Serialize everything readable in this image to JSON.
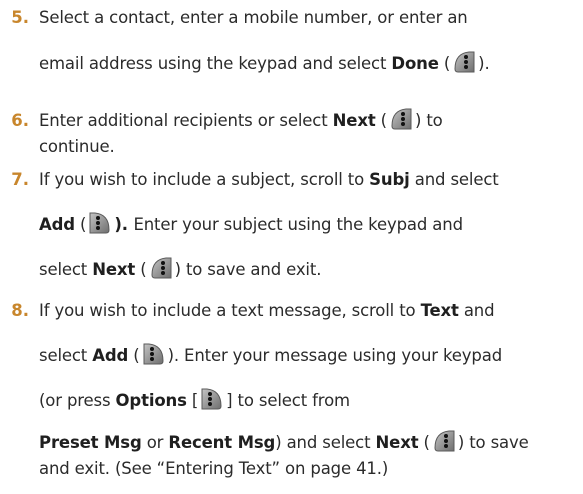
{
  "colors": {
    "step_number": "#c8862c",
    "text": "#2b2b2b",
    "key_dark": "#4a4a4a",
    "key_light": "#9a9a9a"
  },
  "icons": {
    "left_softkey": "left-softkey-icon",
    "right_softkey": "right-softkey-icon"
  },
  "steps": [
    {
      "num": "5.",
      "l1": "Select a contact, enter a mobile number, or enter an",
      "l2a": "email address using the keypad and select ",
      "l2b": "Done",
      "l2c": " (",
      "l2d": ")."
    },
    {
      "num": "6.",
      "l1a": "Enter additional recipients or select ",
      "l1b": "Next",
      "l1c": " (",
      "l1d": ") to",
      "l2": "continue."
    },
    {
      "num": "7.",
      "l1a": "If you wish to include a subject, scroll to ",
      "l1b": "Subj",
      "l1c": " and select",
      "l2a": "Add",
      "l2b": " (",
      "l2c": "). ",
      "l2d": "Enter your subject using the keypad and",
      "l3a": "select ",
      "l3b": "Next",
      "l3c": " (",
      "l3d": ") to save and exit."
    },
    {
      "num": "8.",
      "l1a": "If you wish to include a text message, scroll to ",
      "l1b": "Text",
      "l1c": " and",
      "l2a": "select ",
      "l2b": "Add",
      "l2c": " (",
      "l2d": "). Enter your message using your keypad",
      "l3a": "(or press ",
      "l3b": "Options",
      "l3c": " [",
      "l3d": "] to select from",
      "l4a": "Preset Msg",
      "l4b": " or ",
      "l4c": "Recent Msg",
      "l4d": ") and select ",
      "l4e": "Next",
      "l4f": " (",
      "l4g": ") to save",
      "l5": "and exit. (See “Entering Text” on page 41.)"
    }
  ]
}
